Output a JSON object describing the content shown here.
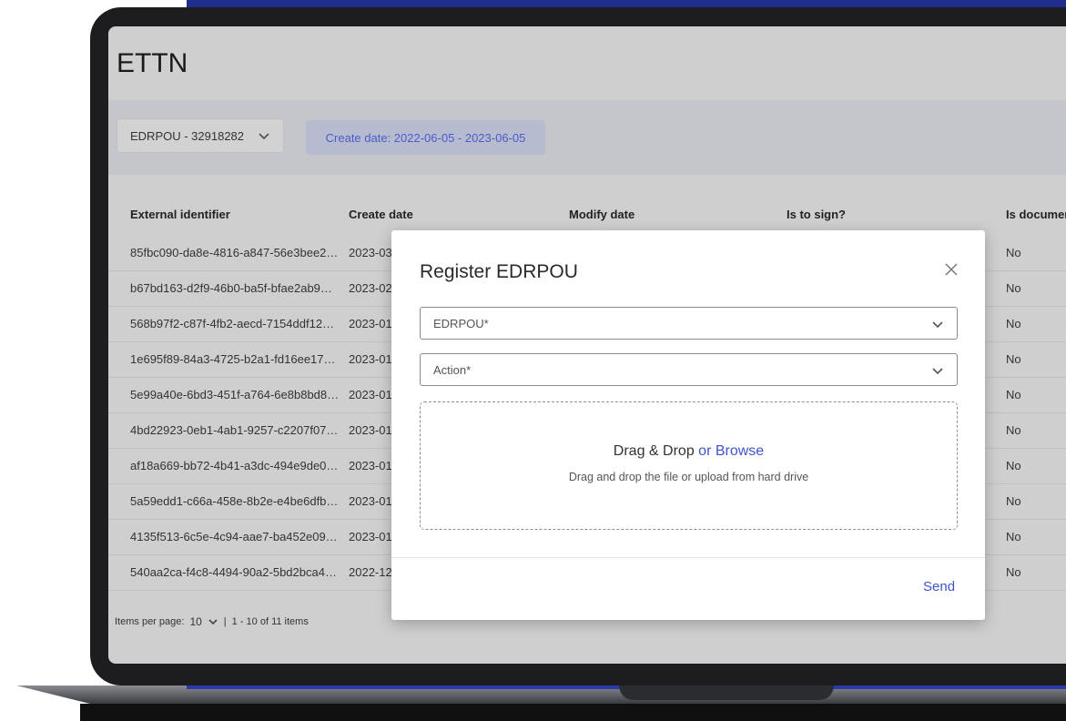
{
  "app": {
    "title": "ETTN"
  },
  "filters": {
    "edrpou_select": "EDRPOU - 32918282",
    "date_chip": "Create date: 2022-06-05 - 2023-06-05"
  },
  "table": {
    "headers": [
      "External identifier",
      "Create date",
      "Modify date",
      "Is to sign?",
      "Is documer"
    ],
    "rows": [
      {
        "id": "85fbc090-da8e-4816-a847-56e3bee2…",
        "create": "2023-03",
        "doc": "No"
      },
      {
        "id": "b67bd163-d2f9-46b0-ba5f-bfae2ab9…",
        "create": "2023-02",
        "doc": "No"
      },
      {
        "id": "568b97f2-c87f-4fb2-aecd-7154ddf12…",
        "create": "2023-01",
        "doc": "No"
      },
      {
        "id": "1e695f89-84a3-4725-b2a1-fd16ee17…",
        "create": "2023-01",
        "doc": "No"
      },
      {
        "id": "5e99a40e-6bd3-451f-a764-6e8b8bd8…",
        "create": "2023-01",
        "doc": "No"
      },
      {
        "id": "4bd22923-0eb1-4ab1-9257-c2207f07…",
        "create": "2023-01",
        "doc": "No"
      },
      {
        "id": "af18a669-bb72-4b41-a3dc-494e9de0…",
        "create": "2023-01",
        "doc": "No"
      },
      {
        "id": "5a59edd1-c66a-458e-8b2e-e4be6dfb…",
        "create": "2023-01",
        "doc": "No"
      },
      {
        "id": "4135f513-6c5e-4c94-aae7-ba452e09…",
        "create": "2023-01",
        "doc": "No"
      },
      {
        "id": "540aa2ca-f4c8-4494-90a2-5bd2bca4…",
        "create": "2022-12",
        "doc": "No"
      }
    ]
  },
  "pager": {
    "label": "Items per page:",
    "per_page": "10",
    "separator": "|",
    "range": "1 - 10 of 11 items"
  },
  "modal": {
    "title": "Register EDRPOU",
    "edrpou_placeholder": "EDRPOU*",
    "action_placeholder": "Action*",
    "drop_title": "Drag & Drop",
    "drop_browse": "or Browse",
    "drop_subtitle": "Drag and drop the file or upload from hard drive",
    "send_label": "Send"
  },
  "icons": {
    "select_chevron": "chevron-down-icon",
    "close": "close-icon"
  },
  "colors": {
    "accent": "#3d55c9",
    "chip_bg": "#b7bbd0",
    "screen_overlay": "#cfcfcf",
    "laptop_blue": "#1f2c8c"
  }
}
